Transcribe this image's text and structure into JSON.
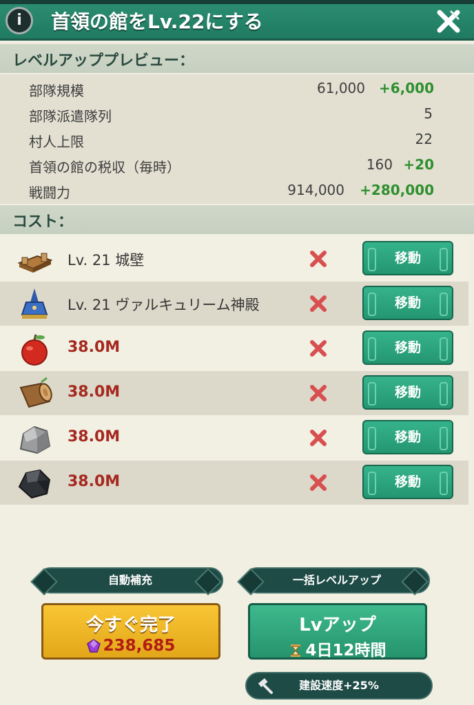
{
  "header": {
    "info_icon": "info-icon",
    "title": "首領の館をLv.22にする",
    "close_icon": "close-icon"
  },
  "preview": {
    "heading": "レベルアッププレビュー：",
    "rows": [
      {
        "label": "部隊規模",
        "value": "61,000",
        "increase": "+6,000"
      },
      {
        "label": "部隊派遣隊列",
        "value": "5",
        "increase": ""
      },
      {
        "label": "村人上限",
        "value": "22",
        "increase": ""
      },
      {
        "label": "首領の館の税収（毎時）",
        "value": "160",
        "increase": "+20"
      },
      {
        "label": "戦闘力",
        "value": "914,000",
        "increase": "+280,000"
      }
    ]
  },
  "cost": {
    "heading": "コスト：",
    "rows": [
      {
        "icon": "wall-icon",
        "text": "Lv. 21  城壁",
        "kind": "requirement",
        "status_icon": "x-icon",
        "button": "移動"
      },
      {
        "icon": "temple-icon",
        "text": "Lv. 21  ヴァルキュリーム神殿",
        "kind": "requirement",
        "status_icon": "x-icon",
        "button": "移動"
      },
      {
        "icon": "apple-icon",
        "text": "38.0M",
        "kind": "resource",
        "status_icon": "x-icon",
        "button": "移動"
      },
      {
        "icon": "wood-log-icon",
        "text": "38.0M",
        "kind": "resource",
        "status_icon": "x-icon",
        "button": "移動"
      },
      {
        "icon": "stone-icon",
        "text": "38.0M",
        "kind": "resource",
        "status_icon": "x-icon",
        "button": "移動"
      },
      {
        "icon": "iron-ore-icon",
        "text": "38.0M",
        "kind": "resource",
        "status_icon": "x-icon",
        "button": "移動"
      }
    ]
  },
  "actions": {
    "auto_refill": "自動補充",
    "bulk_levelup": "一括レベルアップ",
    "instant_label": "今すぐ完了",
    "instant_cost": "238,685",
    "levelup_label": "Lvアップ",
    "levelup_time": "4日12時間",
    "speed_bonus": "建設速度+25%"
  },
  "colors": {
    "header": "#228165",
    "accent_green": "#2e8f2e",
    "missing_red": "#a5291f",
    "gold_button": "#f0b826",
    "green_button": "#2ea67e"
  }
}
